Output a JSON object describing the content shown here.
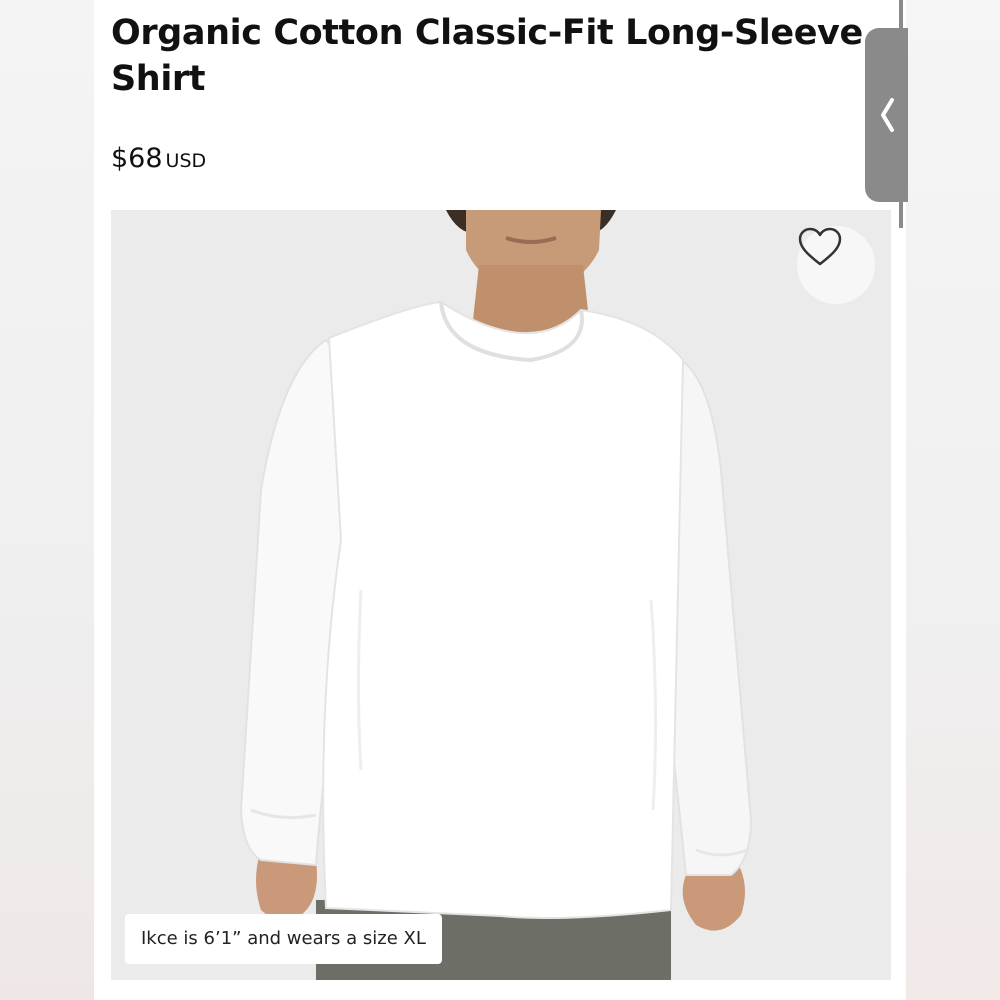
{
  "product": {
    "title": "Organic Cotton Classic-Fit Long-Sleeve Shirt",
    "price": "$68",
    "currency": "USD"
  },
  "image": {
    "caption": "Ikce is 6’1” and wears a size XL",
    "favorite_icon": "heart-icon"
  },
  "side_panel": {
    "icon": "chevron-left-icon"
  },
  "colors": {
    "text": "#111111",
    "image_background": "#ebebeb",
    "shirt": "#ffffff",
    "side_tab": "#8a8a8a"
  }
}
